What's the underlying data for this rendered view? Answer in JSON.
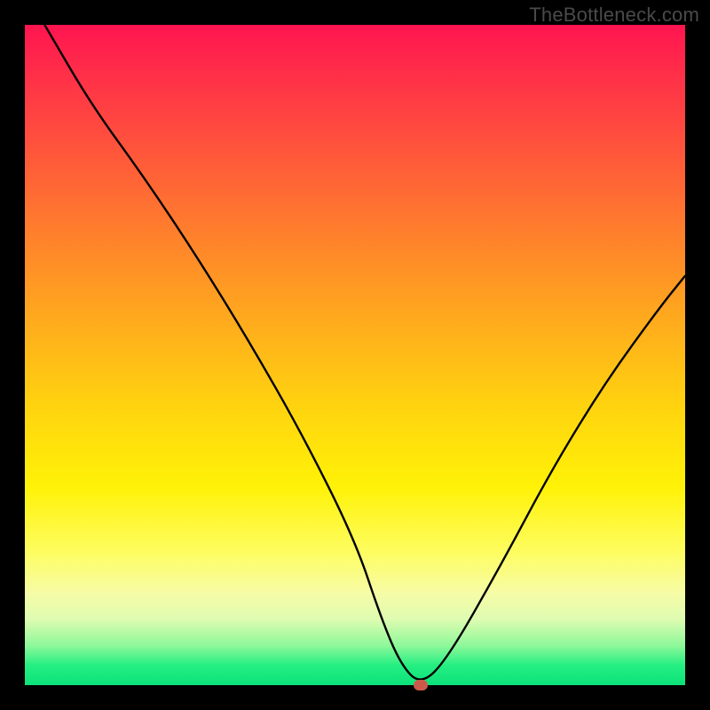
{
  "watermark": "TheBottleneck.com",
  "chart_data": {
    "type": "line",
    "title": "",
    "xlabel": "",
    "ylabel": "",
    "xlim": [
      0,
      100
    ],
    "ylim": [
      0,
      100
    ],
    "series": [
      {
        "name": "bottleneck-curve",
        "x": [
          3,
          10,
          18,
          26,
          34,
          42,
          50,
          54,
          57,
          60,
          64,
          72,
          80,
          88,
          96,
          100
        ],
        "y": [
          100,
          88,
          77,
          65,
          52,
          38,
          22,
          10,
          3,
          0,
          4,
          18,
          33,
          46,
          57,
          62
        ]
      }
    ],
    "marker": {
      "x": 60,
      "y": 0,
      "color": "#cc5a4a"
    },
    "background_gradient": {
      "top": "#ff1450",
      "mid": "#ffd40f",
      "bottom": "#0be27a"
    }
  }
}
